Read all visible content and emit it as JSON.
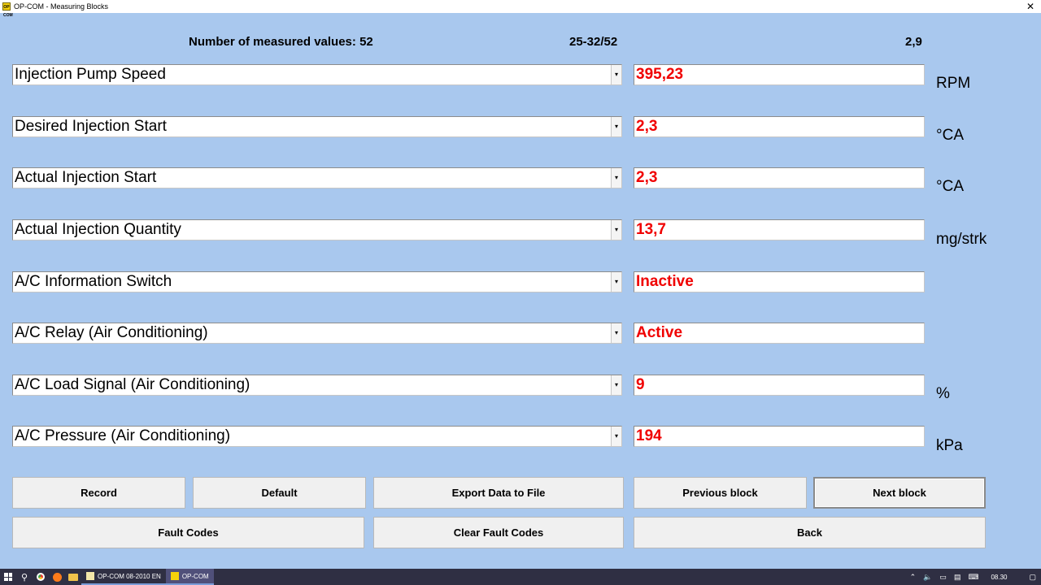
{
  "window": {
    "title": "OP-COM - Measuring Blocks",
    "app_icon_text": "OP COM",
    "close_glyph": "✕"
  },
  "header": {
    "count_label": "Number of measured values: 52",
    "range_label": "25-32/52",
    "time_label": "2,9"
  },
  "rows": [
    {
      "label": "Injection Pump Speed",
      "value": "395,23",
      "unit": "RPM"
    },
    {
      "label": "Desired Injection Start",
      "value": "2,3",
      "unit": "°CA"
    },
    {
      "label": "Actual Injection Start",
      "value": "2,3",
      "unit": "°CA"
    },
    {
      "label": "Actual Injection Quantity",
      "value": "13,7",
      "unit": "mg/strk"
    },
    {
      "label": "A/C Information Switch",
      "value": "Inactive",
      "unit": ""
    },
    {
      "label": "A/C Relay (Air Conditioning)",
      "value": "Active",
      "unit": ""
    },
    {
      "label": "A/C Load Signal (Air Conditioning)",
      "value": "9",
      "unit": "%"
    },
    {
      "label": "A/C Pressure (Air Conditioning)",
      "value": "194",
      "unit": "kPa"
    }
  ],
  "buttons": {
    "record": "Record",
    "default": "Default",
    "export": "Export Data to File",
    "previous": "Previous block",
    "next": "Next block",
    "fault_codes": "Fault Codes",
    "clear_fault_codes": "Clear Fault Codes",
    "back": "Back"
  },
  "taskbar": {
    "tasks": [
      {
        "label": "OP-COM 08-2010 EN"
      },
      {
        "label": "OP-COM"
      }
    ],
    "clock": "08.30",
    "icons": [
      "windows-start-icon",
      "search-icon",
      "chrome-icon",
      "firefox-icon",
      "file-explorer-icon",
      "chevron-up-icon",
      "volume-icon",
      "battery-icon",
      "network-icon",
      "keyboard-icon",
      "notification-icon"
    ]
  },
  "colors": {
    "background": "#a9c8ee",
    "value_text": "#f00000",
    "taskbar": "#2f2f43"
  }
}
